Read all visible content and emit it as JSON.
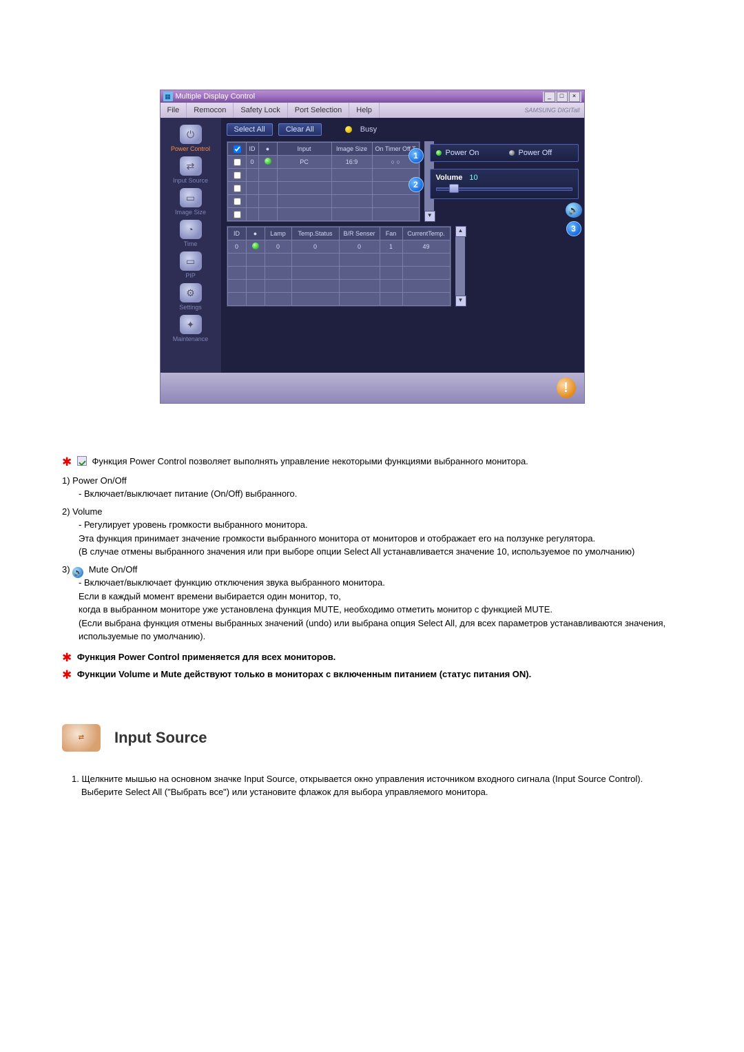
{
  "window": {
    "title": "Multiple Display Control",
    "menus": [
      "File",
      "Remocon",
      "Safety Lock",
      "Port Selection",
      "Help"
    ],
    "brand": "SAMSUNG DIGITall"
  },
  "sidebar": {
    "items": [
      {
        "label": "Power Control",
        "glyph": "⏻",
        "active": true
      },
      {
        "label": "Input Source",
        "glyph": "⇄"
      },
      {
        "label": "Image Size",
        "glyph": "▭"
      },
      {
        "label": "Time",
        "glyph": "◔"
      },
      {
        "label": "PIP",
        "glyph": "▭"
      },
      {
        "label": "Settings",
        "glyph": "⚙"
      },
      {
        "label": "Maintenance",
        "glyph": "✦"
      }
    ]
  },
  "toolbar": {
    "select_all": "Select All",
    "clear_all": "Clear All",
    "busy": "Busy"
  },
  "grid1": {
    "headers": [
      "",
      "ID",
      "",
      "Input",
      "Image Size",
      "On Timer Off T"
    ],
    "rows": [
      [
        "chk",
        "0",
        "dot",
        "PC",
        "16:9",
        "○   ○"
      ]
    ],
    "empty_rows": 4
  },
  "grid2": {
    "headers": [
      "ID",
      "",
      "Lamp",
      "Temp.Status",
      "B/R Senser",
      "Fan",
      "CurrentTemp."
    ],
    "rows": [
      [
        "0",
        "dot",
        "0",
        "0",
        "0",
        "1",
        "49"
      ]
    ],
    "empty_rows": 4
  },
  "power_panel": {
    "on": "Power On",
    "off": "Power Off"
  },
  "volume_panel": {
    "label": "Volume",
    "value": "10"
  },
  "callouts": {
    "c1": "1",
    "c2": "2",
    "c3": "3"
  },
  "article": {
    "intro": "Функция Power Control позволяет выполнять управление некоторыми функциями выбранного монитора.",
    "items": [
      {
        "num": "1) ",
        "head": "Power On/Off",
        "sub": [
          "- Включает/выключает питание (On/Off) выбранного."
        ]
      },
      {
        "num": "2) ",
        "head": "Volume",
        "sub": [
          "- Регулирует уровень громкости выбранного монитора.",
          "Эта функция принимает значение громкости выбранного монитора от мониторов и отображает его на ползунке регулятора.",
          "(В случае отмены выбранного значения или при выборе опции Select All устанавливается значение 10, используемое по умолчанию)"
        ]
      },
      {
        "num": "3) ",
        "head": "Mute On/Off",
        "mute_icon": true,
        "sub": [
          "- Включает/выключает функцию отключения звука выбранного монитора.",
          "Если в каждый момент времени выбирается один монитор, то,",
          "когда в выбранном мониторе уже установлена функция MUTE, необходимо отметить монитор с функцией MUTE.",
          "(Если выбрана функция отмены выбранных значений (undo) или выбрана опция Select All, для всех параметров устанавливаются значения, используемые по умолчанию)."
        ]
      }
    ],
    "notes": [
      "Функция Power Control применяется для всех мониторов.",
      "Функции Volume и Mute действуют только в мониторах с включенным питанием (статус питания ON)."
    ]
  },
  "section": {
    "title": "Input Source",
    "steps": [
      "Щелкните мышью на основном значке Input Source, открывается окно управления источником входного сигнала (Input Source Control).",
      "Выберите Select All (\"Выбрать все\") или установите флажок для выбора управляемого монитора."
    ]
  }
}
